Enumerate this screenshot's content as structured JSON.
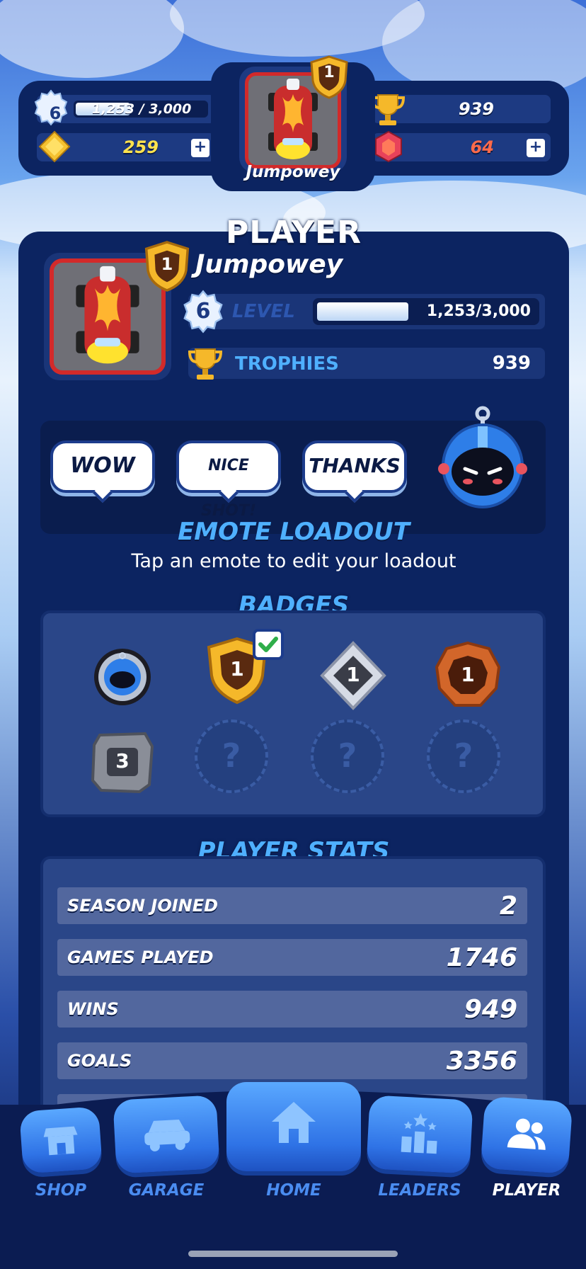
{
  "hud": {
    "level": "6",
    "xp_text": "1,253 / 3,000",
    "xp_fraction": 0.42,
    "coins": "259",
    "trophies": "939",
    "gems": "64",
    "plus_symbol": "+",
    "rank": "1",
    "player_name": "Jumpowey"
  },
  "profile": {
    "title": "PLAYER",
    "name": "Jumpowey",
    "rank": "1",
    "level": "6",
    "level_label": "LEVEL",
    "xp_text": "1,253/3,000",
    "xp_fraction": 0.42,
    "trophies_label": "TROPHIES",
    "trophies": "939"
  },
  "emotes": {
    "items": [
      "WOW",
      "NICE SHOT!",
      "THANKS"
    ],
    "title": "EMOTE LOADOUT",
    "hint": "Tap an emote to edit your loadout"
  },
  "badges": {
    "title": "BADGES",
    "items": [
      {
        "type": "helmet-badge-icon"
      },
      {
        "type": "gold-shield-badge-icon",
        "value": "1",
        "selected": true
      },
      {
        "type": "silver-diamond-badge-icon",
        "value": "1"
      },
      {
        "type": "bronze-badge-icon",
        "value": "1"
      },
      {
        "type": "stone-badge-icon",
        "value": "3"
      },
      {
        "type": "locked-badge",
        "value": "?"
      },
      {
        "type": "locked-badge",
        "value": "?"
      },
      {
        "type": "locked-badge",
        "value": "?"
      }
    ]
  },
  "stats": {
    "title": "PLAYER STATS",
    "rows": [
      {
        "label": "SEASON JOINED",
        "value": "2"
      },
      {
        "label": "GAMES PLAYED",
        "value": "1746"
      },
      {
        "label": "WINS",
        "value": "949"
      },
      {
        "label": "GOALS",
        "value": "3356"
      }
    ]
  },
  "nav": {
    "items": [
      {
        "label": "SHOP",
        "icon": "shop-icon"
      },
      {
        "label": "GARAGE",
        "icon": "car-icon"
      },
      {
        "label": "HOME",
        "icon": "home-icon"
      },
      {
        "label": "LEADERS",
        "icon": "leaderboard-icon"
      },
      {
        "label": "PLAYER",
        "icon": "players-icon",
        "active": true
      }
    ]
  },
  "colors": {
    "panel": "#0c2461",
    "accent_blue": "#4fb0ff",
    "frame_red": "#d22a2a",
    "gold": "#ffe24d"
  }
}
